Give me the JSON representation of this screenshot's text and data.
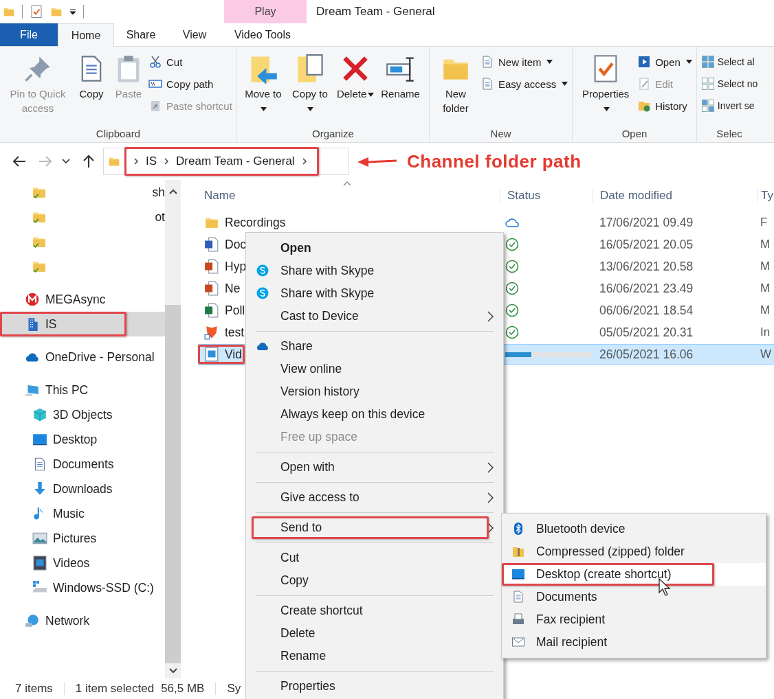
{
  "window": {
    "title": "Dream Team - General"
  },
  "contextual_tab_group": {
    "label": "Play"
  },
  "tabs": [
    {
      "label": "File",
      "kind": "file",
      "selected": false
    },
    {
      "label": "Home",
      "kind": "normal",
      "selected": true
    },
    {
      "label": "Share",
      "kind": "normal",
      "selected": false
    },
    {
      "label": "View",
      "kind": "normal",
      "selected": false
    },
    {
      "label": "Video Tools",
      "kind": "contextual",
      "selected": false
    }
  ],
  "ribbon_groups": [
    {
      "label": "Clipboard",
      "commands": [
        {
          "label": "Pin to Quick access",
          "kind": "large",
          "disabled": true,
          "dropdown": false
        },
        {
          "label": "Copy",
          "kind": "large",
          "disabled": false,
          "dropdown": false
        },
        {
          "label": "Paste",
          "kind": "large",
          "disabled": true,
          "dropdown": false
        },
        {
          "label": "Cut",
          "kind": "small",
          "disabled": false,
          "dropdown": false
        },
        {
          "label": "Copy path",
          "kind": "small",
          "disabled": false,
          "dropdown": false
        },
        {
          "label": "Paste shortcut",
          "kind": "small",
          "disabled": true,
          "dropdown": false
        }
      ]
    },
    {
      "label": "Organize",
      "commands": [
        {
          "label": "Move to",
          "kind": "large",
          "disabled": false,
          "dropdown": true
        },
        {
          "label": "Copy to",
          "kind": "large",
          "disabled": false,
          "dropdown": true
        },
        {
          "label": "Delete",
          "kind": "large",
          "disabled": false,
          "dropdown": true
        },
        {
          "label": "Rename",
          "kind": "large",
          "disabled": false,
          "dropdown": false
        }
      ]
    },
    {
      "label": "New",
      "commands": [
        {
          "label": "New folder",
          "kind": "large",
          "disabled": false,
          "dropdown": false
        },
        {
          "label": "New item",
          "kind": "small",
          "disabled": false,
          "dropdown": true
        },
        {
          "label": "Easy access",
          "kind": "small",
          "disabled": false,
          "dropdown": true
        }
      ]
    },
    {
      "label": "Open",
      "commands": [
        {
          "label": "Properties",
          "kind": "large",
          "disabled": false,
          "dropdown": true
        },
        {
          "label": "Open",
          "kind": "small",
          "disabled": false,
          "dropdown": true
        },
        {
          "label": "Edit",
          "kind": "small",
          "disabled": true,
          "dropdown": false
        },
        {
          "label": "History",
          "kind": "small",
          "disabled": false,
          "dropdown": false
        }
      ]
    },
    {
      "label": "Selec",
      "commands": [
        {
          "label": "Select al",
          "kind": "small",
          "disabled": false,
          "dropdown": false
        },
        {
          "label": "Select no",
          "kind": "small",
          "disabled": false,
          "dropdown": false
        },
        {
          "label": "Invert se",
          "kind": "small",
          "disabled": false,
          "dropdown": false
        }
      ]
    }
  ],
  "address_bar": {
    "crumbs": [
      "IS",
      "Dream Team - General"
    ],
    "annotated": true
  },
  "annotation": {
    "text": "Channel folder path"
  },
  "sidebar": {
    "items": [
      {
        "label": "sh",
        "selected": false,
        "annotated": false
      },
      {
        "label": "ot",
        "selected": false,
        "annotated": false
      },
      {
        "selected": false,
        "annotated": false
      },
      {
        "selected": false,
        "annotated": false
      },
      {
        "label": "MEGAsync",
        "selected": false,
        "annotated": false
      },
      {
        "label": "IS",
        "selected": true,
        "annotated": true
      },
      {
        "label": "OneDrive - Personal",
        "selected": false,
        "annotated": false
      },
      {
        "label": "This PC",
        "selected": false,
        "annotated": false,
        "children": [
          {
            "label": "3D Objects",
            "selected": false
          },
          {
            "label": "Desktop",
            "selected": false
          },
          {
            "label": "Documents",
            "selected": false
          },
          {
            "label": "Downloads",
            "selected": false
          },
          {
            "label": "Music",
            "selected": false
          },
          {
            "label": "Pictures",
            "selected": false
          },
          {
            "label": "Videos",
            "selected": false
          },
          {
            "label": "Windows-SSD (C:)",
            "selected": false
          }
        ]
      },
      {
        "label": "Network",
        "selected": false,
        "annotated": false
      }
    ]
  },
  "file_list": {
    "columns": [
      "Name",
      "Status",
      "Date modified",
      "Ty"
    ],
    "rows": [
      {
        "name": "Recordings",
        "status": {
          "kind": "online-only"
        },
        "date": "17/06/2021 09.49",
        "type": "F",
        "selected": false,
        "annotated": false
      },
      {
        "name": "Doc",
        "status": {
          "kind": "synced"
        },
        "date": "16/05/2021 20.05",
        "type": "M",
        "selected": false,
        "annotated": false
      },
      {
        "name": "Hyp",
        "status": {
          "kind": "synced"
        },
        "date": "13/06/2021 20.58",
        "type": "M",
        "selected": false,
        "annotated": false
      },
      {
        "name": "Ne",
        "status": {
          "kind": "synced"
        },
        "date": "16/06/2021 23.49",
        "type": "M",
        "selected": false,
        "annotated": false
      },
      {
        "name": "Poll",
        "status": {
          "kind": "synced"
        },
        "date": "06/06/2021 18.54",
        "type": "M",
        "selected": false,
        "annotated": false
      },
      {
        "name": "test",
        "status": {
          "kind": "synced"
        },
        "date": "05/05/2021 20.31",
        "type": "In",
        "selected": false,
        "annotated": false
      },
      {
        "name": "Vid",
        "status": {
          "kind": "syncing",
          "level": 0.3
        },
        "date": "26/05/2021 16.06",
        "type": "W",
        "selected": true,
        "annotated": true
      }
    ]
  },
  "context_menu": {
    "items": [
      {
        "kind": "item",
        "label": "Open",
        "default": true,
        "disabled": false,
        "submenu": false,
        "annotated": false
      },
      {
        "kind": "item",
        "label": "Share with Skype",
        "default": false,
        "disabled": false,
        "submenu": false,
        "annotated": false
      },
      {
        "kind": "item",
        "label": "Share with Skype",
        "default": false,
        "disabled": false,
        "submenu": false,
        "annotated": false
      },
      {
        "kind": "item",
        "label": "Cast to Device",
        "default": false,
        "disabled": false,
        "submenu": true,
        "annotated": false
      },
      {
        "kind": "separator"
      },
      {
        "kind": "item",
        "label": "Share",
        "default": false,
        "disabled": false,
        "submenu": false,
        "annotated": false
      },
      {
        "kind": "item",
        "label": "View online",
        "default": false,
        "disabled": false,
        "submenu": false,
        "annotated": false
      },
      {
        "kind": "item",
        "label": "Version history",
        "default": false,
        "disabled": false,
        "submenu": false,
        "annotated": false
      },
      {
        "kind": "item",
        "label": "Always keep on this device",
        "default": false,
        "disabled": false,
        "submenu": false,
        "annotated": false
      },
      {
        "kind": "item",
        "label": "Free up space",
        "default": false,
        "disabled": true,
        "submenu": false,
        "annotated": false
      },
      {
        "kind": "separator"
      },
      {
        "kind": "item",
        "label": "Open with",
        "default": false,
        "disabled": false,
        "submenu": true,
        "annotated": false
      },
      {
        "kind": "separator"
      },
      {
        "kind": "item",
        "label": "Give access to",
        "default": false,
        "disabled": false,
        "submenu": true,
        "annotated": false
      },
      {
        "kind": "separator"
      },
      {
        "kind": "item",
        "label": "Send to",
        "default": false,
        "disabled": false,
        "submenu": true,
        "annotated": true
      },
      {
        "kind": "separator"
      },
      {
        "kind": "item",
        "label": "Cut",
        "default": false,
        "disabled": false,
        "submenu": false,
        "annotated": false
      },
      {
        "kind": "item",
        "label": "Copy",
        "default": false,
        "disabled": false,
        "submenu": false,
        "annotated": false
      },
      {
        "kind": "separator"
      },
      {
        "kind": "item",
        "label": "Create shortcut",
        "default": false,
        "disabled": false,
        "submenu": false,
        "annotated": false
      },
      {
        "kind": "item",
        "label": "Delete",
        "default": false,
        "disabled": false,
        "submenu": false,
        "annotated": false
      },
      {
        "kind": "item",
        "label": "Rename",
        "default": false,
        "disabled": false,
        "submenu": false,
        "annotated": false
      },
      {
        "kind": "separator"
      },
      {
        "kind": "item",
        "label": "Properties",
        "default": false,
        "disabled": false,
        "submenu": false,
        "annotated": false
      }
    ]
  },
  "send_to_menu": {
    "items": [
      {
        "label": "Bluetooth device",
        "selected": false,
        "annotated": false
      },
      {
        "label": "Compressed (zipped) folder",
        "selected": false,
        "annotated": false
      },
      {
        "label": "Desktop (create shortcut)",
        "selected": true,
        "annotated": true
      },
      {
        "label": "Documents",
        "selected": false,
        "annotated": false
      },
      {
        "label": "Fax recipient",
        "selected": false,
        "annotated": false
      },
      {
        "label": "Mail recipient",
        "selected": false,
        "annotated": false
      }
    ]
  },
  "status_bar": {
    "item_count": "7 items",
    "selection": "1 item selected",
    "size": "56,5 MB",
    "field_4": "Sy"
  }
}
